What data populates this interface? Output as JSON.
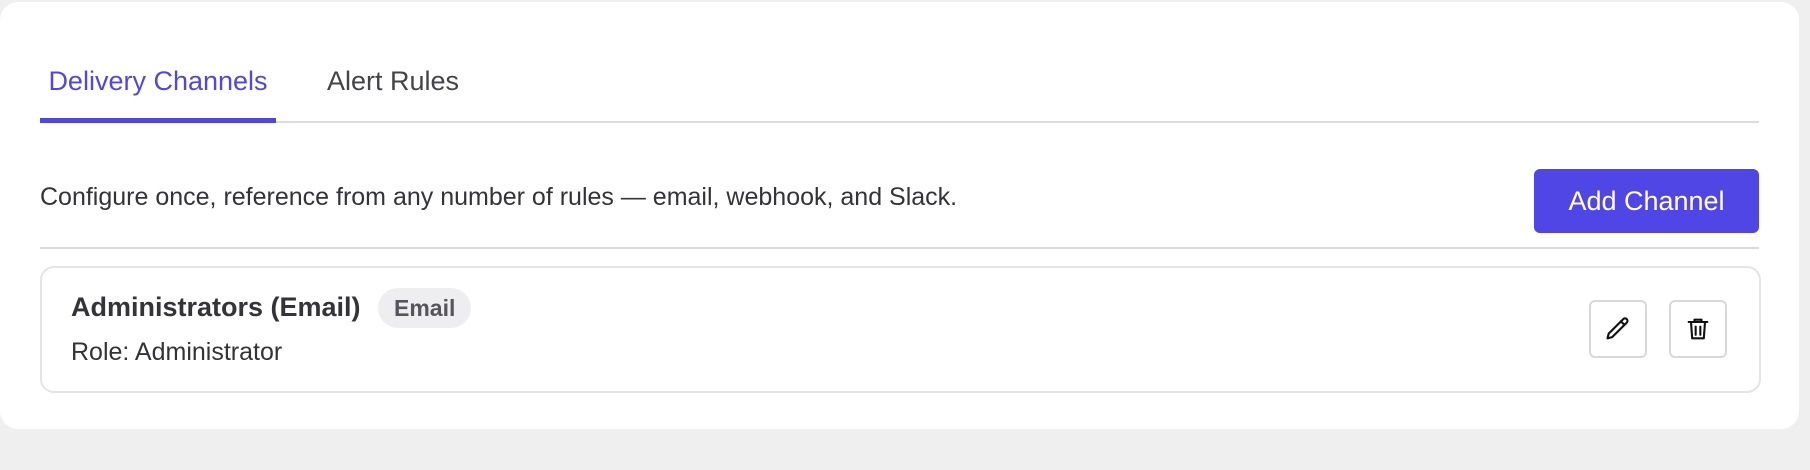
{
  "tabs": [
    {
      "label": "Delivery Channels",
      "active": true
    },
    {
      "label": "Alert Rules",
      "active": false
    }
  ],
  "toolbar": {
    "description": "Configure once, reference from any number of rules — email, webhook, and Slack.",
    "add_label": "Add Channel"
  },
  "channels": [
    {
      "name": "Administrators (Email)",
      "type_badge": "Email",
      "detail": "Role: Administrator",
      "actions": [
        {
          "icon": "pencil-icon"
        },
        {
          "icon": "trash-icon"
        }
      ]
    }
  ],
  "colors": {
    "accent": "#4f46e5",
    "page_background": "#efefef",
    "card_background": "#ffffff",
    "badge_background": "#eeeef0",
    "text": "#333338"
  }
}
